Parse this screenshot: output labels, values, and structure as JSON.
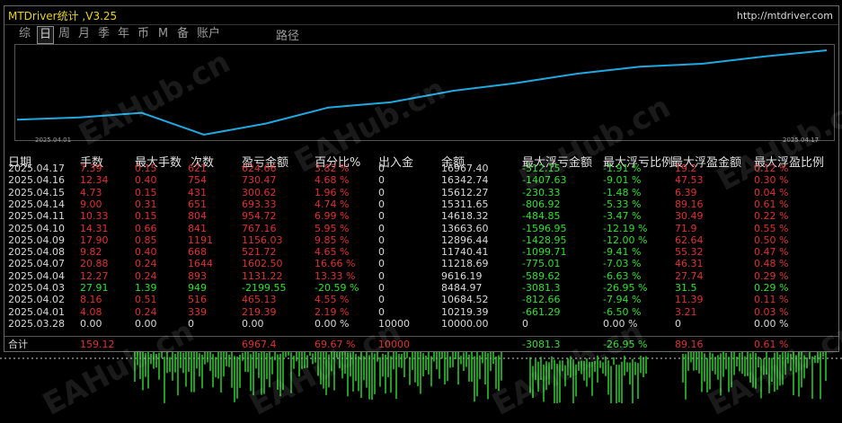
{
  "title": "MTDriver统计 ,V3.25",
  "url": "http://mtdriver.com",
  "tabs": [
    "综",
    "日",
    "周",
    "月",
    "季",
    "年",
    "币",
    "M",
    "备",
    "账户"
  ],
  "active_tab": 1,
  "tab_path": "路径",
  "chart": {
    "start_label": "2025.04.01",
    "end_label": "2025.04.17",
    "line_color": "#1fa9e0"
  },
  "headers": [
    "日期",
    "手数",
    "最大手数",
    "次数",
    "盈亏金额",
    "百分比%",
    "出入金",
    "余额",
    "最大浮亏金额",
    "最大浮亏比例",
    "最大浮盈金额",
    "最大浮盈比例"
  ],
  "rows": [
    [
      "2025.04.17",
      "7.39",
      "0.15",
      "621",
      "624.66",
      "3.82 %",
      "0",
      "16967.40",
      "-312.15",
      "-1.91 %",
      "19.2",
      "0.12 %"
    ],
    [
      "2025.04.16",
      "12.34",
      "0.40",
      "754",
      "730.47",
      "4.68 %",
      "0",
      "16342.74",
      "-1407.63",
      "-9.01 %",
      "47.53",
      "0.30 %"
    ],
    [
      "2025.04.15",
      "4.73",
      "0.15",
      "431",
      "300.62",
      "1.96 %",
      "0",
      "15612.27",
      "-230.33",
      "-1.48 %",
      "6.39",
      "0.04 %"
    ],
    [
      "2025.04.14",
      "9.00",
      "0.31",
      "651",
      "693.33",
      "4.74 %",
      "0",
      "15311.65",
      "-806.92",
      "-5.33 %",
      "89.16",
      "0.61 %"
    ],
    [
      "2025.04.11",
      "10.33",
      "0.15",
      "804",
      "954.72",
      "6.99 %",
      "0",
      "14618.32",
      "-484.85",
      "-3.47 %",
      "30.49",
      "0.22 %"
    ],
    [
      "2025.04.10",
      "14.31",
      "0.66",
      "841",
      "767.16",
      "5.95 %",
      "0",
      "13663.60",
      "-1596.95",
      "-12.19 %",
      "71.9",
      "0.55 %"
    ],
    [
      "2025.04.09",
      "17.90",
      "0.85",
      "1191",
      "1156.03",
      "9.85 %",
      "0",
      "12896.44",
      "-1428.95",
      "-12.00 %",
      "62.64",
      "0.50 %"
    ],
    [
      "2025.04.08",
      "9.82",
      "0.40",
      "668",
      "521.72",
      "4.65 %",
      "0",
      "11740.41",
      "-1099.71",
      "-9.41 %",
      "55.32",
      "0.47 %"
    ],
    [
      "2025.04.07",
      "20.88",
      "0.24",
      "1644",
      "1602.50",
      "16.66 %",
      "0",
      "11218.69",
      "-775.01",
      "-7.03 %",
      "46.31",
      "0.48 %"
    ],
    [
      "2025.04.04",
      "12.27",
      "0.24",
      "893",
      "1131.22",
      "13.33 %",
      "0",
      "9616.19",
      "-589.62",
      "-6.63 %",
      "27.74",
      "0.29 %"
    ],
    [
      "2025.04.03",
      "27.91",
      "1.39",
      "949",
      "-2199.55",
      "-20.59 %",
      "0",
      "8484.97",
      "-3081.3",
      "-26.95 %",
      "31.5",
      "0.29 %"
    ],
    [
      "2025.04.02",
      "8.16",
      "0.51",
      "516",
      "465.13",
      "4.55 %",
      "0",
      "10684.52",
      "-812.66",
      "-7.94 %",
      "11.39",
      "0.11 %"
    ],
    [
      "2025.04.01",
      "4.08",
      "0.24",
      "339",
      "219.39",
      "2.19 %",
      "0",
      "10219.39",
      "-661.29",
      "-6.50 %",
      "3.21",
      "0.03 %"
    ],
    [
      "2025.03.28",
      "0.00",
      "0.00",
      "0",
      "0.00",
      "0.00 %",
      "10000",
      "10000.00",
      "0",
      "0.00 %",
      "0",
      "0.00 %"
    ]
  ],
  "total": [
    "合计",
    "159.12",
    "",
    "",
    "6967.4",
    "69.67 %",
    "10000",
    "",
    "-3081.3",
    "-26.95 %",
    "89.16",
    "0.61 %"
  ],
  "watermark": "EAHub.cn",
  "colors": {
    "profit": "#e03030",
    "loss": "#2ee02e",
    "neutral": "#d8d8d8",
    "title": "#e6d21c"
  }
}
